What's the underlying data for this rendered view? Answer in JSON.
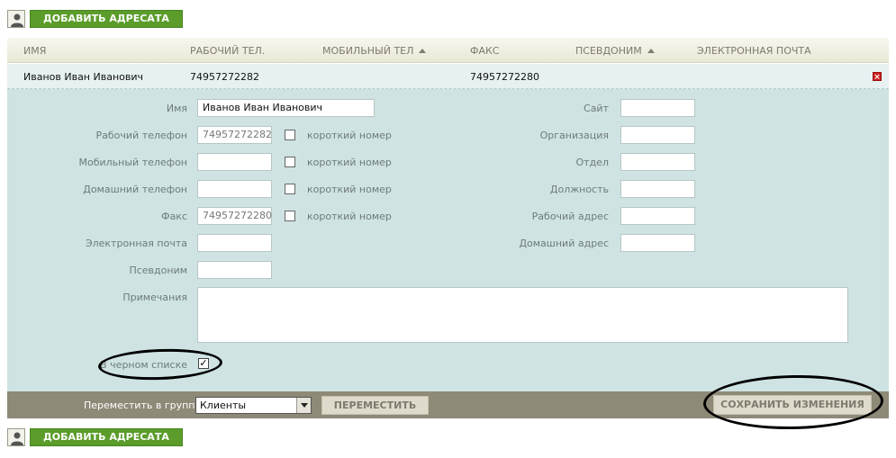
{
  "add_contact": {
    "label": "ДОБАВИТЬ АДРЕСАТА"
  },
  "table": {
    "headers": [
      "ИМЯ",
      "РАБОЧИЙ ТЕЛ.",
      "МОБИЛЬНЫЙ ТЕЛ",
      "ФАКС",
      "ПСЕВДОНИМ",
      "ЭЛЕКТРОННАЯ ПОЧТА"
    ],
    "row": {
      "name": "Иванов Иван Иванович",
      "work_phone": "74957272282",
      "mobile_phone": "",
      "fax": "74957272280",
      "nickname": "",
      "email": ""
    }
  },
  "form": {
    "left": {
      "name": {
        "label": "Имя",
        "value": "Иванов Иван Иванович"
      },
      "work_phone": {
        "label": "Рабочий телефон",
        "value": "74957272282"
      },
      "mobile_phone": {
        "label": "Мобильный телефон",
        "value": ""
      },
      "home_phone": {
        "label": "Домашний телефон",
        "value": ""
      },
      "fax": {
        "label": "Факс",
        "value": "74957272280"
      },
      "email": {
        "label": "Электронная почта",
        "value": ""
      },
      "nickname": {
        "label": "Псевдоним",
        "value": ""
      },
      "notes": {
        "label": "Примечания",
        "value": ""
      }
    },
    "short_number_label": "короткий номер",
    "right": {
      "site": {
        "label": "Сайт",
        "value": ""
      },
      "organization": {
        "label": "Организация",
        "value": ""
      },
      "department": {
        "label": "Отдел",
        "value": ""
      },
      "position": {
        "label": "Должность",
        "value": ""
      },
      "work_address": {
        "label": "Рабочий адрес",
        "value": ""
      },
      "home_address": {
        "label": "Домашний адрес",
        "value": ""
      }
    },
    "blacklist": {
      "label": "В черном списке",
      "checked": true,
      "mark": "✓"
    }
  },
  "actions": {
    "move_label": "Переместить в группу",
    "group_selected": "Клиенты",
    "move_button": "ПЕРЕМЕСТИТЬ",
    "save_button": "СОХРАНИТЬ ИЗМЕНЕНИЯ"
  },
  "icons": {
    "delete": "×"
  }
}
